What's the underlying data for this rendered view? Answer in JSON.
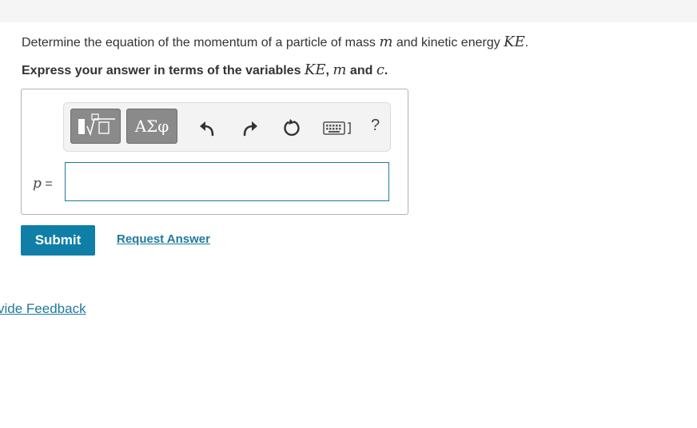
{
  "question": {
    "prefix": "Determine the equation of the momentum of a particle of mass ",
    "mass_var": "m",
    "middle": " and kinetic energy ",
    "ke_var": "KE",
    "suffix": "."
  },
  "instruction": {
    "prefix": "Express your answer in terms of the variables ",
    "var1": "KE",
    "sep1": ", ",
    "var2": "m",
    "sep2": " and ",
    "var3": "c",
    "suffix": "."
  },
  "toolbar": {
    "symbols_label": "ΑΣφ",
    "help_label": "?",
    "icons": [
      "template-icon",
      "symbols-icon",
      "undo-icon",
      "redo-icon",
      "reset-icon",
      "keyboard-icon",
      "help-icon"
    ]
  },
  "answer": {
    "variable": "p",
    "equals": " =",
    "value": ""
  },
  "actions": {
    "submit_label": "Submit",
    "request_label": "Request Answer",
    "feedback_label": "vide Feedback"
  },
  "colors": {
    "accent": "#0f7fa8",
    "link": "#1f7a9b",
    "toolbar_button": "#8a8a8a"
  }
}
